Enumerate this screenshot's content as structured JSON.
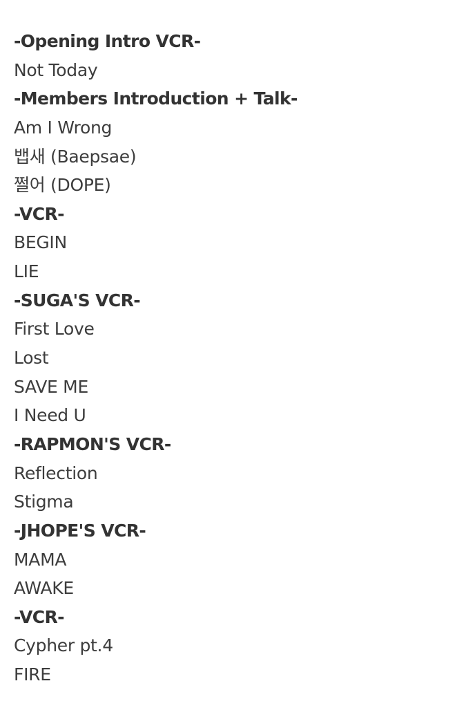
{
  "setlist": {
    "lines": [
      {
        "text": "-Opening Intro VCR-",
        "type": "header"
      },
      {
        "text": "Not Today",
        "type": "song"
      },
      {
        "text": "-Members Introduction + Talk-",
        "type": "header"
      },
      {
        "text": "Am I Wrong",
        "type": "song"
      },
      {
        "text": "뱁새 (Baepsae)",
        "type": "song"
      },
      {
        "text": "쩔어 (DOPE)",
        "type": "song"
      },
      {
        "text": "-VCR-",
        "type": "header"
      },
      {
        "text": "BEGIN",
        "type": "song"
      },
      {
        "text": "LIE",
        "type": "song"
      },
      {
        "text": "-SUGA'S VCR-",
        "type": "header"
      },
      {
        "text": "First Love",
        "type": "song"
      },
      {
        "text": "Lost",
        "type": "song"
      },
      {
        "text": "SAVE ME",
        "type": "song"
      },
      {
        "text": "I Need U",
        "type": "song"
      },
      {
        "text": "-RAPMON'S VCR-",
        "type": "header"
      },
      {
        "text": "Reflection",
        "type": "song"
      },
      {
        "text": "Stigma",
        "type": "song"
      },
      {
        "text": "-JHOPE'S VCR-",
        "type": "header"
      },
      {
        "text": "MAMA",
        "type": "song"
      },
      {
        "text": "AWAKE",
        "type": "song"
      },
      {
        "text": "-VCR-",
        "type": "header"
      },
      {
        "text": "Cypher pt.4",
        "type": "song"
      },
      {
        "text": "FIRE",
        "type": "song"
      }
    ]
  }
}
